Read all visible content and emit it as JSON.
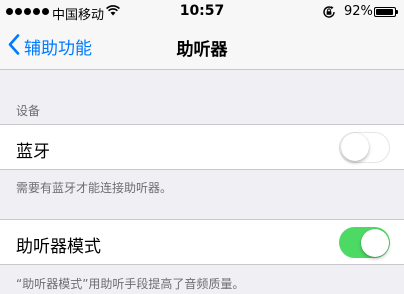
{
  "status_bar": {
    "carrier": "中国移动",
    "time": "10:57",
    "battery_percent": "92%",
    "battery_level": 0.92,
    "icons": [
      "signal-dots-icon",
      "wifi-icon",
      "rotation-lock-icon",
      "battery-icon"
    ]
  },
  "nav": {
    "back_label": "辅助功能",
    "title": "助听器"
  },
  "devices_section": {
    "header": "设备",
    "bluetooth": {
      "label": "蓝牙",
      "enabled": false
    },
    "note": "需要有蓝牙才能连接助听器。"
  },
  "hearing_aid_mode": {
    "label": "助听器模式",
    "enabled": true,
    "note": "“助听器模式”用助听手段提高了音频质量。"
  },
  "colors": {
    "accent": "#007aff",
    "toggle_on": "#4cd964",
    "background": "#efeff4"
  }
}
